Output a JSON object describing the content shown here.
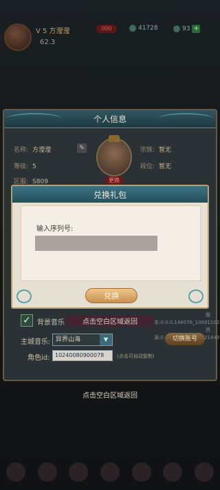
{
  "top": {
    "vip": "V 5 方瀅瀅",
    "level": "62.3",
    "power": "000",
    "gold": "41728",
    "gems": "93",
    "plus": "+"
  },
  "panel": {
    "title": "个人信息",
    "name_label": "名称:",
    "name_value": "方瀅瀅",
    "level_label": "等级:",
    "level_value": "5",
    "server_label": "区服:",
    "server_value": "S809",
    "clan_label": "宗族:",
    "clan_value": "暂无",
    "rank_label": "段位:",
    "rank_value": "暂无",
    "change_avatar": "更换"
  },
  "settings": {
    "bg_music_label": "背景音乐",
    "bg_music_checked": "✓",
    "main_music_label": "主城音乐:",
    "main_music_value": "异界山海",
    "switch_account": "切换账号",
    "role_id_label": "角色id:",
    "role_id_value": "10240080900078",
    "copy_hint": "(点击可自动复制)",
    "version_line1": "版本:0.0.0.146076_10091102",
    "version_line2": "资源:0.0.0.146012_10121449"
  },
  "dialog": {
    "title": "兑换礼包",
    "serial_label": "输入序列号:",
    "serial_value": "",
    "redeem_button": "兑换"
  },
  "tap_return_inner": "点击空白区域返回",
  "tap_return_outer": "点击空白区域返回"
}
